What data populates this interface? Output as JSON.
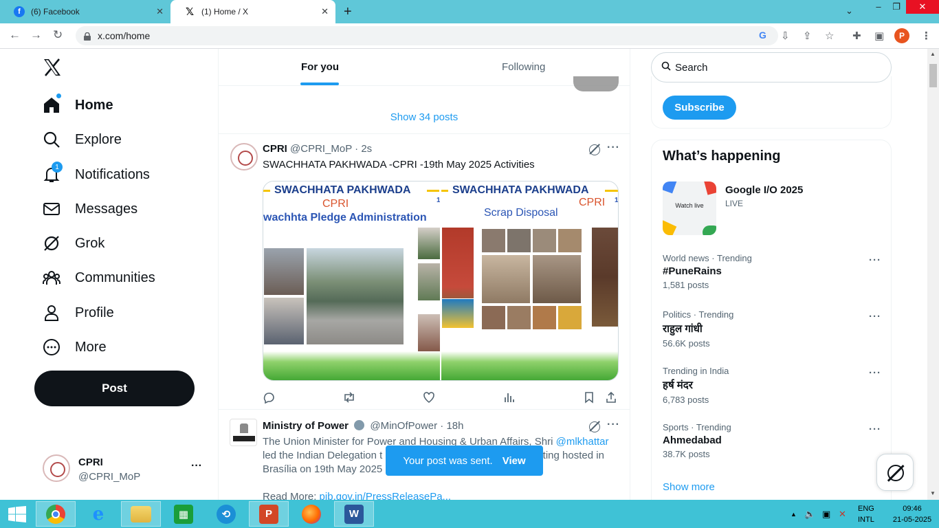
{
  "browser": {
    "tabs": [
      {
        "title": "(6) Facebook",
        "icon": "facebook-icon"
      },
      {
        "title": "(1) Home / X",
        "icon": "x-icon"
      }
    ],
    "url": "x.com/home",
    "profile_initial": "P"
  },
  "nav": {
    "items": [
      {
        "label": "Home",
        "icon": "home-icon"
      },
      {
        "label": "Explore",
        "icon": "search-icon"
      },
      {
        "label": "Notifications",
        "icon": "bell-icon",
        "badge": "1"
      },
      {
        "label": "Messages",
        "icon": "envelope-icon"
      },
      {
        "label": "Grok",
        "icon": "grok-icon"
      },
      {
        "label": "Communities",
        "icon": "people-icon"
      },
      {
        "label": "Profile",
        "icon": "person-icon"
      },
      {
        "label": "More",
        "icon": "more-circle-icon"
      }
    ],
    "post_label": "Post",
    "account": {
      "name": "CPRI",
      "handle": "@CPRI_MoP",
      "menu": "···"
    }
  },
  "feed": {
    "tabs": [
      "For you",
      "Following"
    ],
    "show_posts": "Show 34 posts",
    "tweets": [
      {
        "name": "CPRI",
        "handle": "@CPRI_MoP · 2s",
        "text": "SWACHHATA PAKHWADA -CPRI -19th May 2025 Activities",
        "media": {
          "left_title": "SWACHHATA PAKHWADA",
          "left_org": "CPRI",
          "left_caption": "wachhta Pledge Administration",
          "right_title": "SWACHHATA PAKHWADA",
          "right_org": "CPRI",
          "right_caption": "Scrap Disposal",
          "page_marker": "1"
        }
      },
      {
        "name": "Ministry of Power",
        "handle": "@MinOfPower · 18h",
        "text_a": "The Union Minister for Power and Housing & Urban Affairs, Shri ",
        "mention": "@mlkhattar",
        "text_b": "led the Indian Delegation t",
        "text_b2": "eeting hosted in",
        "text_c": "Brasília on 19th May 2025",
        "readmore": "Read More: ",
        "link": "pib.gov.in/PressReleasePa..."
      }
    ],
    "toast": {
      "text": "Your post was sent.",
      "action": "View"
    }
  },
  "sidebar": {
    "search_placeholder": "Search",
    "subscribe_label": "Subscribe",
    "trends_title": "What’s happening",
    "event": {
      "title": "Google I/O 2025",
      "status": "LIVE",
      "image_text": "Watch live"
    },
    "trends": [
      {
        "meta": "World news · Trending",
        "name": "#PuneRains",
        "count": "1,581 posts"
      },
      {
        "meta": "Politics · Trending",
        "name": "राहुल गांधी",
        "count": "56.6K posts"
      },
      {
        "meta": "Trending in India",
        "name": "हर्ष मंदर",
        "count": "6,783 posts"
      },
      {
        "meta": "Sports · Trending",
        "name": "Ahmedabad",
        "count": "38.7K posts"
      }
    ],
    "show_more": "Show more"
  },
  "taskbar": {
    "apps": [
      "Chrome",
      "Internet Explorer",
      "File Explorer",
      "Store",
      "App",
      "PowerPoint",
      "Firefox",
      "Word"
    ],
    "lang_top": "ENG",
    "lang_bottom": "INTL",
    "time": "09:46",
    "date": "21-05-2025"
  },
  "colors": {
    "accent": "#1d9bf0",
    "taskbar": "#3fc2d6",
    "tabbar": "#5fc7d8"
  }
}
